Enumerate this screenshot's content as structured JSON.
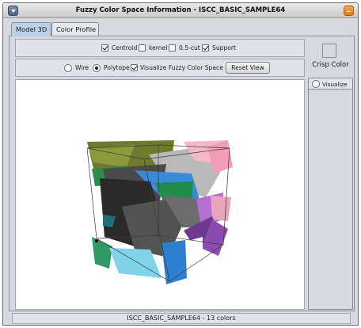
{
  "window": {
    "title": "Fuzzy Color Space Information - ISCC_BASIC_SAMPLE64"
  },
  "tabs": [
    {
      "label": "Model 3D",
      "active": true
    },
    {
      "label": "Color Profile",
      "active": false
    }
  ],
  "options": {
    "centroid": {
      "label": "Centroid",
      "checked": true
    },
    "kernel": {
      "label": "kernel",
      "checked": false
    },
    "alpha_cut": {
      "label": "0.5-cut",
      "checked": false
    },
    "support": {
      "label": "Support",
      "checked": true
    }
  },
  "view": {
    "wire": {
      "label": "Wire",
      "selected": false
    },
    "polytope": {
      "label": "Polytope",
      "selected": true
    },
    "visualize_fcs": {
      "label": "Visualize Fuzzy Color Space",
      "checked": true
    },
    "reset_label": "Reset View"
  },
  "side": {
    "crisp_color_label": "Crisp Color",
    "visualize_label": "Visualize"
  },
  "status": {
    "text": "ISCC_BASIC_SAMPLE64 - 13 colors"
  },
  "colors": {
    "title_bar": "#d8d8d8",
    "active_tab": "#bcd0e8",
    "menu_button": "#5a6f8e",
    "close_button": "#ee8a22"
  }
}
